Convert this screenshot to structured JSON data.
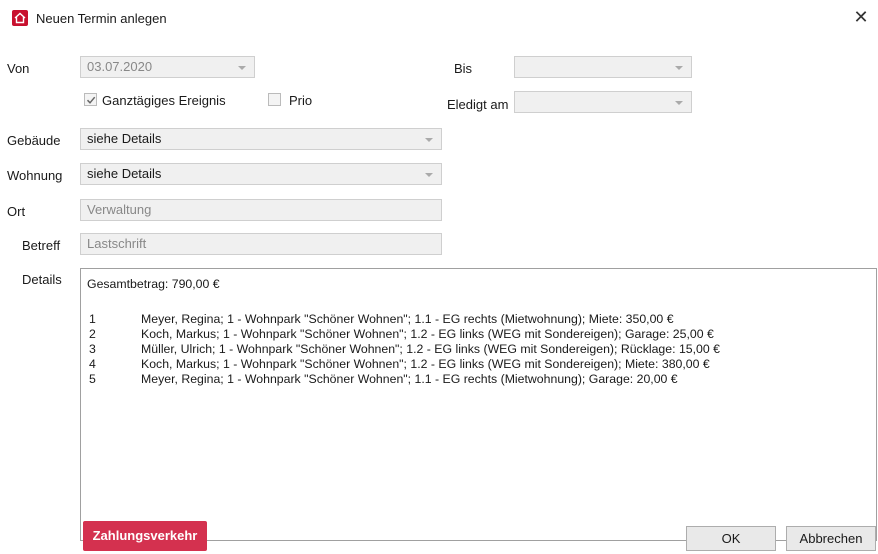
{
  "window": {
    "title": "Neuen Termin anlegen",
    "close_glyph": "✕"
  },
  "form": {
    "von_label": "Von",
    "von_value": "03.07.2020",
    "bis_label": "Bis",
    "bis_value": "",
    "allday_label": "Ganztägiges Ereignis",
    "allday_checked": true,
    "prio_label": "Prio",
    "prio_checked": false,
    "erledigt_label": "Eledigt am",
    "erledigt_value": "",
    "gebaeude_label": "Gebäude",
    "gebaeude_value": "siehe Details",
    "wohnung_label": "Wohnung",
    "wohnung_value": "siehe Details",
    "ort_label": "Ort",
    "ort_placeholder": "Verwaltung",
    "betreff_label": "Betreff",
    "betreff_placeholder": "Lastschrift",
    "details_label": "Details"
  },
  "details": {
    "total": "Gesamtbetrag: 790,00 €",
    "rows": [
      {
        "num": "1",
        "text": "Meyer, Regina; 1 - Wohnpark \"Schöner Wohnen\"; 1.1 - EG rechts (Mietwohnung);  Miete: 350,00 €"
      },
      {
        "num": "2",
        "text": "Koch, Markus; 1 - Wohnpark \"Schöner Wohnen\"; 1.2 - EG links (WEG mit Sondereigen);  Garage: 25,00 €"
      },
      {
        "num": "3",
        "text": "Müller, Ulrich; 1 - Wohnpark \"Schöner Wohnen\"; 1.2 - EG links (WEG mit Sondereigen);  Rücklage: 15,00 €"
      },
      {
        "num": "4",
        "text": "Koch, Markus; 1 - Wohnpark \"Schöner Wohnen\"; 1.2 - EG links (WEG mit Sondereigen);  Miete: 380,00 €"
      },
      {
        "num": "5",
        "text": "Meyer, Regina; 1 - Wohnpark \"Schöner Wohnen\"; 1.1 - EG rechts (Mietwohnung);  Garage: 20,00 €"
      }
    ]
  },
  "buttons": {
    "payment": "Zahlungsverkehr",
    "ok": "OK",
    "cancel": "Abbrechen"
  },
  "colors": {
    "accent": "#d4314f",
    "app_icon": "#c8102e"
  },
  "icons": {
    "app": "house-icon",
    "close": "close-icon",
    "dropdown": "chevron-down-icon",
    "check": "checkmark-icon"
  }
}
